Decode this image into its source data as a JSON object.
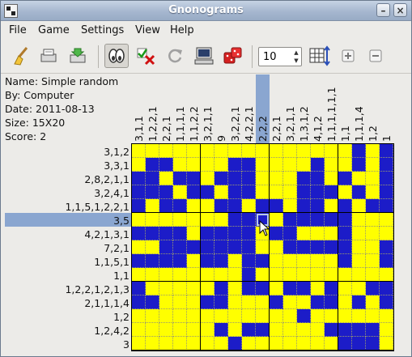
{
  "window": {
    "title": "Gnonograms"
  },
  "menus": [
    "File",
    "Game",
    "Settings",
    "View",
    "Help"
  ],
  "toolbar": {
    "size_value": "10",
    "icons": [
      "broom-icon",
      "load-icon",
      "save-icon",
      "peek-icon",
      "check-errors-icon",
      "restart-icon",
      "computer-icon",
      "random-dice-icon",
      "grid-resize-icon",
      "zoom-in-icon",
      "zoom-out-icon"
    ]
  },
  "info": {
    "name": "Name: Simple random",
    "by": "By: Computer",
    "date": "Date: 2011-08-13",
    "size": "Size: 15X20",
    "score": "Score: 2"
  },
  "colors": {
    "filled": "#1c1cc8",
    "empty": "#ffff00",
    "highlight": "#8aa6d0"
  },
  "highlight": {
    "row": 5,
    "col": 9
  },
  "row_clues": [
    "3,1,2",
    "3,3,1",
    "2,8,2,1,1",
    "3,2,4,1",
    "1,1,5,1,2,2,1",
    "3,5",
    "4,2,1,3,1",
    "7,2,1",
    "1,1,5,1",
    "1,1",
    "1,2,2,1,2,1,3",
    "2,1,1,1,4",
    "1,2",
    "1,2,4,2",
    "3"
  ],
  "col_clues": [
    "3,1,1",
    "1,2,2,1",
    "2,2,1",
    "1,1,1,1",
    "1,1,2,2",
    "3,2,1,1",
    "9",
    "3,2,2,1",
    "4,2,2,1",
    "2,2,2",
    "2,2,1",
    "3,2,1,1",
    "1,3,1,2",
    "4,1,2",
    "1,1,1,1,1,1",
    "1,1",
    "1,1,1,4",
    "1,2",
    "1"
  ],
  "grid": [
    "0000000000000000101",
    "0110000110000100101",
    "1101101110001101001",
    "1110110110001110101",
    "1011001101101101011",
    "0000000111011111000",
    "1111011110110001000",
    "0011111110011111001",
    "1111011011000001001",
    "0000000010000000000",
    "1000001011011010011",
    "1100011000100110101",
    "0000000000001000000",
    "0000001011000011110",
    "0000000100000001110"
  ]
}
